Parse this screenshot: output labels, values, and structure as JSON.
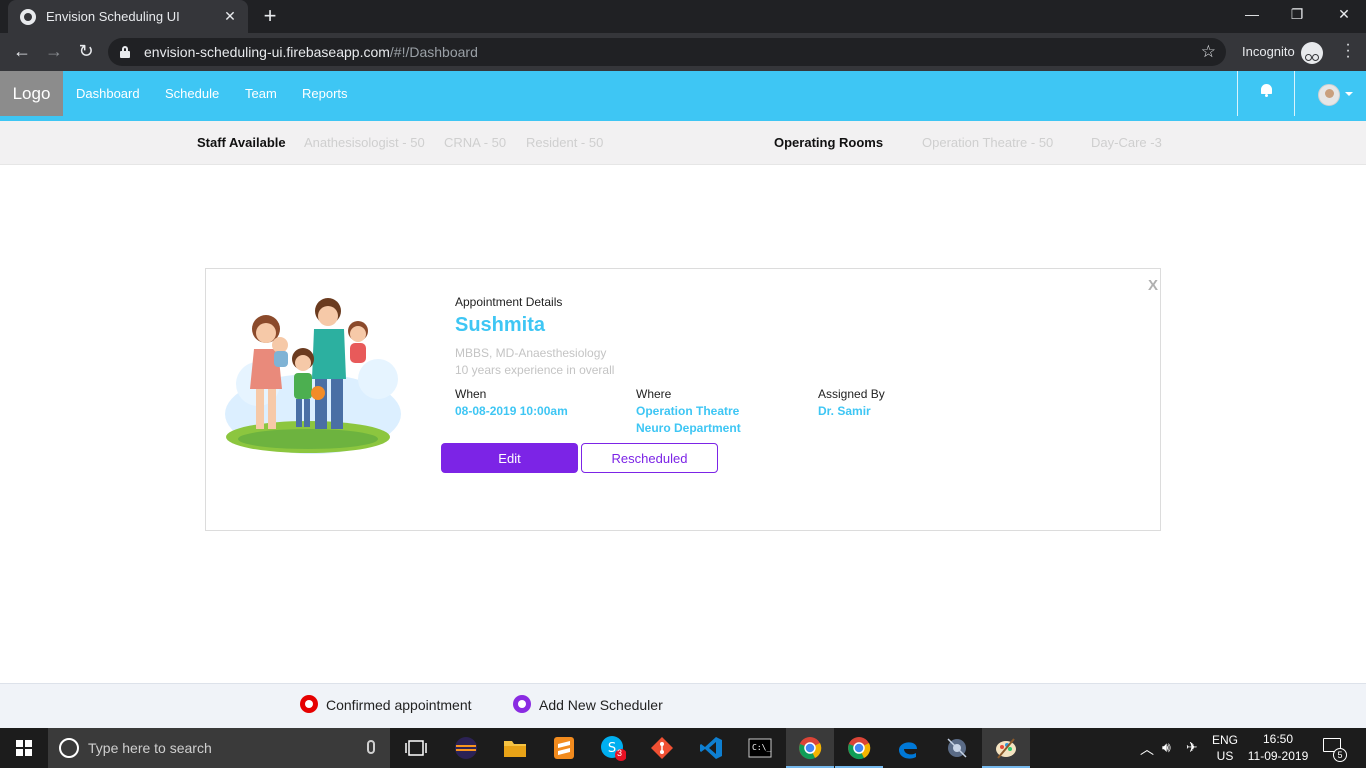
{
  "browser": {
    "tab_title": "Envision Scheduling UI",
    "url_host": "envision-scheduling-ui.firebaseapp.com",
    "url_path": "/#!/Dashboard",
    "incognito_label": "Incognito"
  },
  "nav": {
    "logo": "Logo",
    "links": [
      "Dashboard",
      "Schedule",
      "Team",
      "Reports"
    ]
  },
  "stats": {
    "staff_title": "Staff Available",
    "staff_items": [
      "Anathesisologist - 50",
      "CRNA - 50",
      "Resident - 50"
    ],
    "rooms_title": "Operating Rooms",
    "room_items": [
      "Operation Theatre - 50",
      "Day-Care -3"
    ]
  },
  "appointment": {
    "close_label": "X",
    "heading": "Appointment Details",
    "name": "Sushmita",
    "qualification": "MBBS, MD-Anaesthesiology",
    "experience": "10 years experience in overall",
    "when_label": "When",
    "when_value": "08-08-2019 10:00am",
    "where_label": "Where",
    "where_line1": "Operation Theatre",
    "where_line2": "Neuro Department",
    "assigned_label": "Assigned By",
    "assigned_value": "Dr. Samir",
    "edit_label": "Edit",
    "rescheduled_label": "Rescheduled"
  },
  "legend": {
    "confirmed": "Confirmed appointment",
    "add_new": "Add New Scheduler",
    "confirmed_color": "#e60000",
    "add_new_color": "#8a2be2"
  },
  "taskbar": {
    "search_placeholder": "Type here to search",
    "lang_top": "ENG",
    "lang_bottom": "US",
    "time": "16:50",
    "date": "11-09-2019",
    "notifications": "5",
    "skype_badge": "3"
  },
  "colors": {
    "accent": "#3ec6f4",
    "primary_button": "#7c24e6"
  }
}
